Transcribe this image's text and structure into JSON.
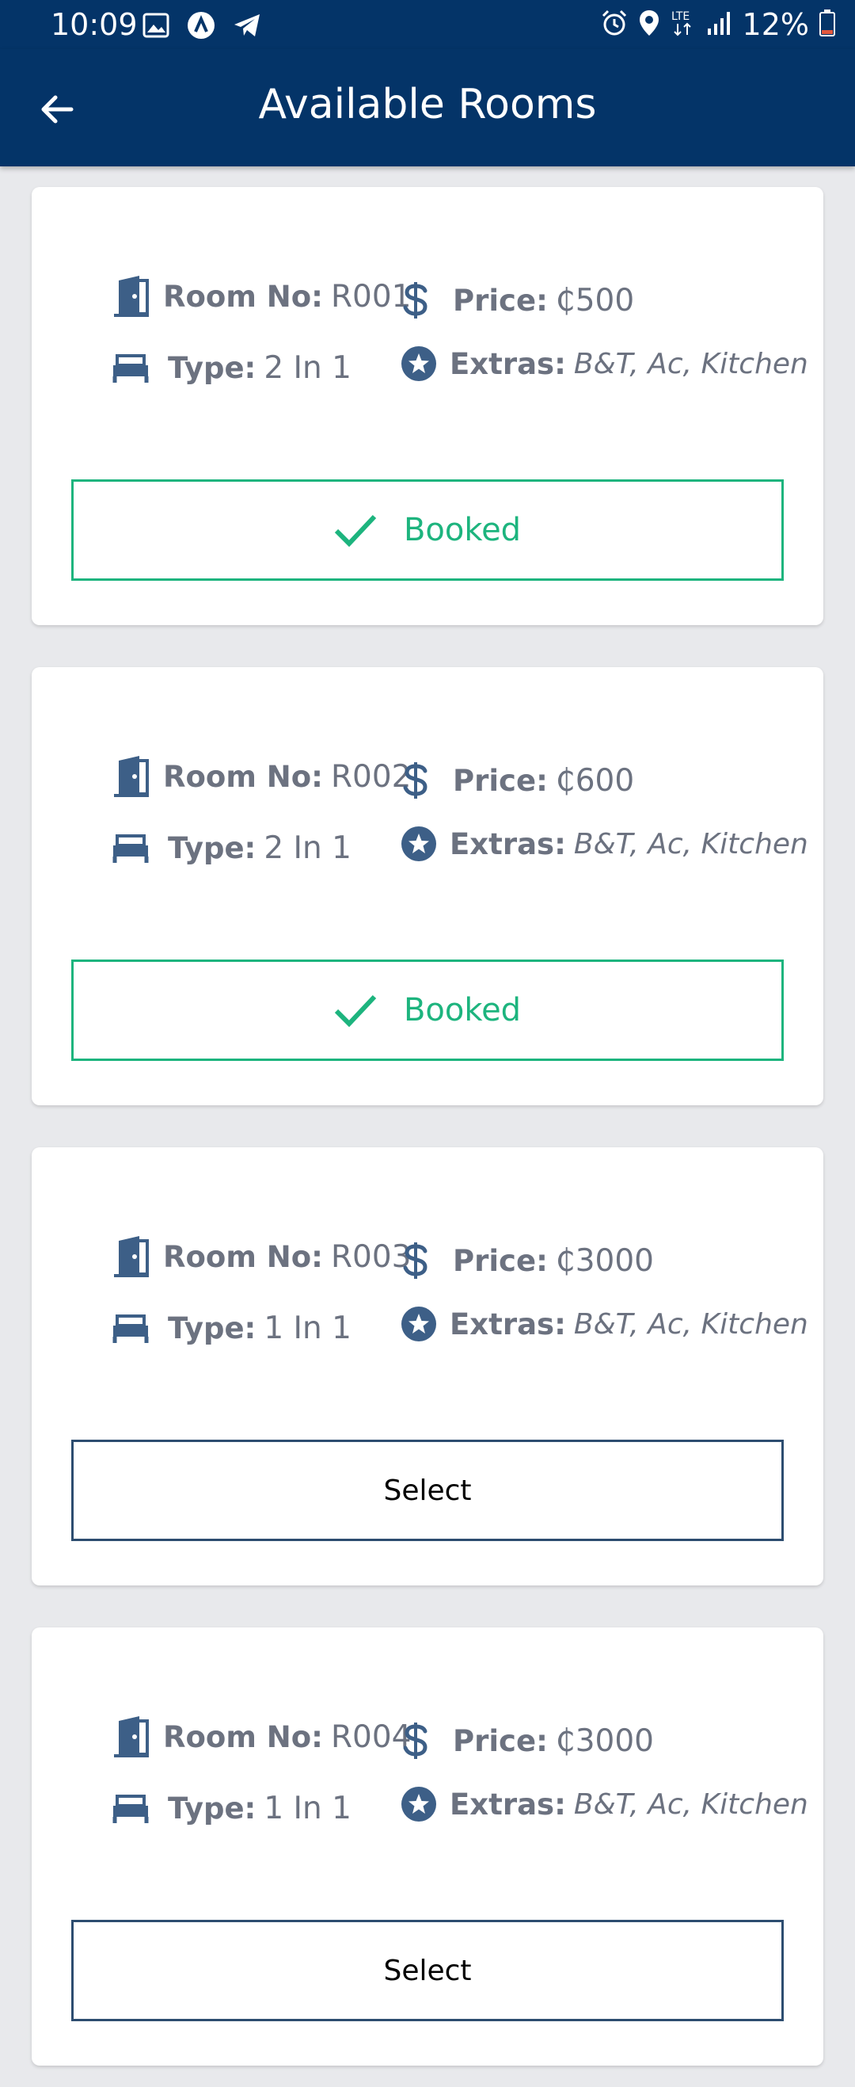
{
  "status_bar": {
    "time": "10:09",
    "battery": "12%",
    "icons_left": [
      "image-icon",
      "app-icon",
      "telegram-icon"
    ],
    "icons_right": [
      "alarm-icon",
      "location-icon",
      "lte-icon",
      "signal-icon",
      "battery-icon"
    ]
  },
  "app_bar": {
    "title": "Available Rooms",
    "back_icon": "arrow-left-icon",
    "background": "#043468"
  },
  "labels": {
    "room_no": "Room No:",
    "price": "Price:",
    "type": "Type:",
    "extras": "Extras:"
  },
  "colors": {
    "icon": "#3d5f87",
    "booked": "#1db47e",
    "select_border": "#2d4d70",
    "text_muted": "#6c7280"
  },
  "rooms": [
    {
      "room_no": "R001",
      "price": "₵500",
      "type": "2 In 1",
      "extras": "B&T, Ac, Kitchen",
      "status": "booked",
      "action_label": "Booked"
    },
    {
      "room_no": "R002",
      "price": "₵600",
      "type": "2 In 1",
      "extras": "B&T, Ac, Kitchen",
      "status": "booked",
      "action_label": "Booked"
    },
    {
      "room_no": "R003",
      "price": "₵3000",
      "type": "1 In 1",
      "extras": "B&T, Ac, Kitchen",
      "status": "available",
      "action_label": "Select"
    },
    {
      "room_no": "R004",
      "price": "₵3000",
      "type": "1 In 1",
      "extras": "B&T, Ac, Kitchen",
      "status": "available",
      "action_label": "Select"
    }
  ]
}
